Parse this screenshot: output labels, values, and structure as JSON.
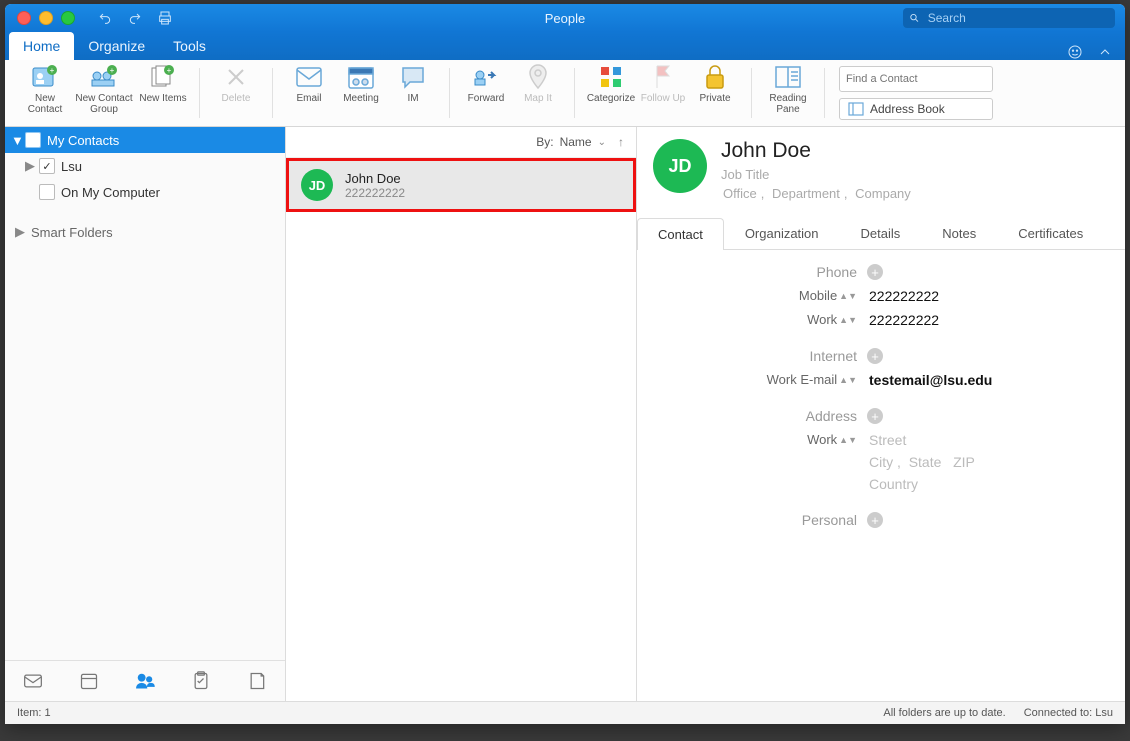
{
  "window_title": "People",
  "search_placeholder": "Search",
  "tabs": {
    "home": "Home",
    "organize": "Organize",
    "tools": "Tools"
  },
  "ribbon": {
    "new_contact": "New Contact",
    "new_group": "New Contact Group",
    "new_items": "New Items",
    "delete": "Delete",
    "email": "Email",
    "meeting": "Meeting",
    "im": "IM",
    "forward": "Forward",
    "mapit": "Map It",
    "categorize": "Categorize",
    "followup": "Follow Up",
    "private": "Private",
    "reading_pane": "Reading Pane",
    "find_contact_ph": "Find a Contact",
    "address_book": "Address Book"
  },
  "sidebar": {
    "my_contacts": "My Contacts",
    "lsu": "Lsu",
    "on_my_computer": "On My Computer",
    "smart_folders": "Smart Folders"
  },
  "list": {
    "sort_label": "By:",
    "sort_value": "Name",
    "items": [
      {
        "initials": "JD",
        "name": "John Doe",
        "sub": "222222222"
      }
    ]
  },
  "detail": {
    "initials": "JD",
    "name": "John Doe",
    "job_title": "Job Title",
    "office": "Office",
    "department": "Department",
    "company": "Company",
    "tabs": {
      "contact": "Contact",
      "organization": "Organization",
      "details": "Details",
      "notes": "Notes",
      "certificates": "Certificates"
    },
    "sections": {
      "phone": "Phone",
      "internet": "Internet",
      "address": "Address",
      "personal": "Personal"
    },
    "fields": {
      "mobile_label": "Mobile",
      "mobile_value": "222222222",
      "work_phone_label": "Work",
      "work_phone_value": "222222222",
      "work_email_label": "Work E-mail",
      "work_email_value": "testemail@lsu.edu",
      "work_addr_label": "Work",
      "street_ph": "Street",
      "city_ph": "City",
      "state_ph": "State",
      "zip_ph": "ZIP",
      "country_ph": "Country"
    }
  },
  "status": {
    "item_count": "Item: 1",
    "sync": "All folders are up to date.",
    "connected": "Connected to: Lsu"
  }
}
